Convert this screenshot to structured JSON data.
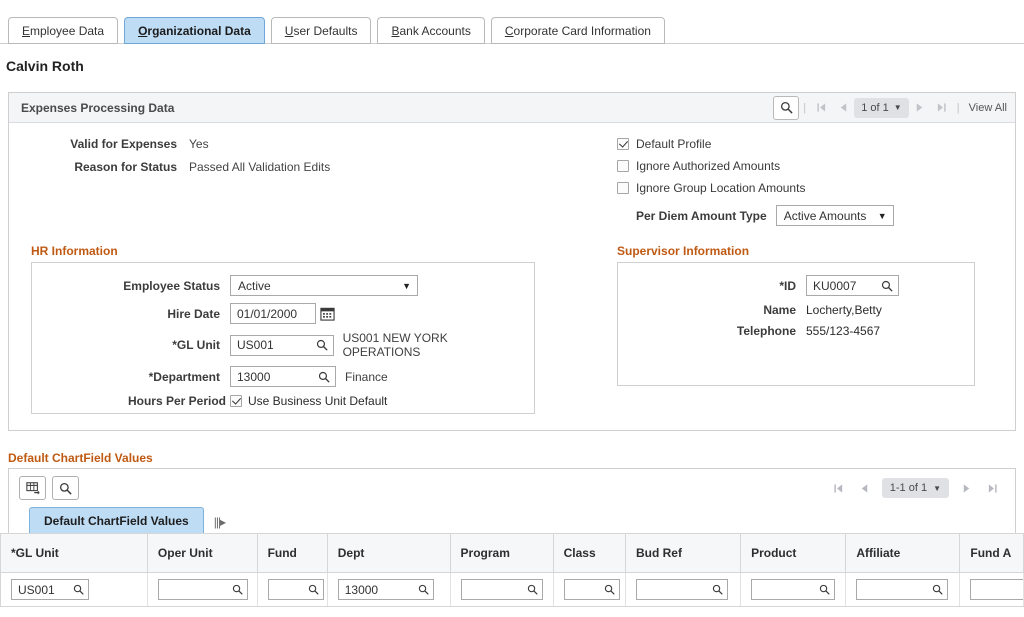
{
  "tabs": [
    {
      "label": "Employee Data",
      "accesskey": "E",
      "active": false
    },
    {
      "label": "Organizational Data",
      "accesskey": "O",
      "active": true
    },
    {
      "label": "User Defaults",
      "accesskey": "U",
      "active": false
    },
    {
      "label": "Bank Accounts",
      "accesskey": "B",
      "active": false
    },
    {
      "label": "Corporate Card Information",
      "accesskey": "C",
      "active": false
    }
  ],
  "page": {
    "title": "Calvin Roth"
  },
  "groupbox": {
    "title": "Expenses Processing Data",
    "nav": {
      "search_icon": "magnifier-icon",
      "first_icon": "first-page-icon",
      "prev_icon": "previous-page-icon",
      "counter": "1 of 1",
      "counter_caret": "▼",
      "next_icon": "next-page-icon",
      "last_icon": "last-page-icon",
      "view_all": "View All"
    }
  },
  "status": {
    "valid_label": "Valid for Expenses",
    "valid_value": "Yes",
    "reason_label": "Reason for Status",
    "reason_value": "Passed All Validation Edits"
  },
  "options": {
    "checkboxes": [
      {
        "label": "Default Profile",
        "checked": true
      },
      {
        "label": "Ignore Authorized Amounts",
        "checked": false
      },
      {
        "label": "Ignore Group Location Amounts",
        "checked": false
      }
    ],
    "per_diem_label": "Per Diem Amount Type",
    "per_diem_value": "Active Amounts",
    "per_diem_caret": "▼"
  },
  "hr": {
    "section_label": "HR Information",
    "employee_status_label": "Employee Status",
    "employee_status_value": "Active",
    "employee_status_caret": "▼",
    "hire_date_label": "Hire Date",
    "hire_date_value": "01/01/2000",
    "hire_date_icon": "calendar-icon",
    "gl_unit_label": "*GL Unit",
    "gl_unit_value": "US001",
    "gl_unit_icon": "lookup-magnifier-icon",
    "gl_unit_desc": "US001 NEW YORK OPERATIONS",
    "department_label": "*Department",
    "department_value": "13000",
    "department_icon": "lookup-magnifier-icon",
    "department_desc": "Finance",
    "hours_label": "Hours Per Period",
    "hours_checkbox_label": "Use Business Unit Default",
    "hours_checked": true
  },
  "supervisor": {
    "section_label": "Supervisor Information",
    "id_label": "*ID",
    "id_value": "KU0007",
    "id_icon": "lookup-magnifier-icon",
    "name_label": "Name",
    "name_value": "Locherty,Betty",
    "telephone_label": "Telephone",
    "telephone_value": "555/123-4567"
  },
  "chartfields": {
    "section_label": "Default ChartField Values",
    "tools": [
      {
        "name": "personalize-grid-icon"
      },
      {
        "name": "find-icon"
      }
    ],
    "nav": {
      "first_icon": "first-page-icon",
      "prev_icon": "previous-page-icon",
      "counter": "1-1 of 1",
      "counter_caret": "▼",
      "next_icon": "next-page-icon",
      "last_icon": "last-page-icon"
    },
    "grid_tab": "Default ChartField Values",
    "expand_icon": "expand-all-columns-icon",
    "columns": [
      "*GL Unit",
      "Oper Unit",
      "Fund",
      "Dept",
      "Program",
      "Class",
      "Bud Ref",
      "Product",
      "Affiliate",
      "Fund A"
    ],
    "rows": [
      {
        "cells": [
          "US001",
          "",
          "",
          "13000",
          "",
          "",
          "",
          "",
          "",
          ""
        ]
      }
    ]
  },
  "colors": {
    "section_label": "#c05a13",
    "active_tab_bg": "#bfdcf5",
    "active_tab_border": "#6fa8d8",
    "header_bg": "#f4f5f7",
    "counter_bg": "#dfe1e5"
  }
}
